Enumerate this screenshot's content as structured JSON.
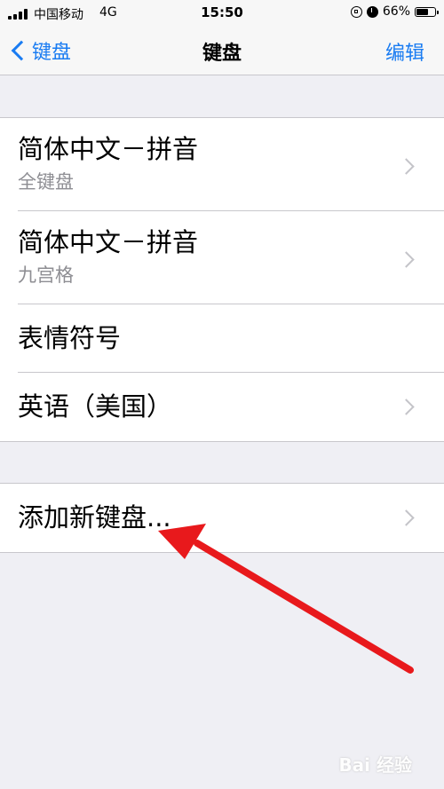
{
  "status_bar": {
    "carrier": "中国移动",
    "network": "4G",
    "time": "15:50",
    "battery": "66%",
    "battery_level": 0.66
  },
  "nav": {
    "back_label": "键盘",
    "title": "键盘",
    "edit_label": "编辑"
  },
  "keyboards": [
    {
      "title": "简体中文－拼音",
      "subtitle": "全键盘"
    },
    {
      "title": "简体中文－拼音",
      "subtitle": "九宫格"
    },
    {
      "title": "表情符号",
      "subtitle": ""
    },
    {
      "title": "英语（美国）",
      "subtitle": ""
    }
  ],
  "add_keyboard": {
    "label": "添加新键盘..."
  },
  "watermark": "Bai 经验",
  "colors": {
    "accent": "#1a7cf2",
    "background": "#efeff4",
    "arrow": "#e8191c"
  }
}
